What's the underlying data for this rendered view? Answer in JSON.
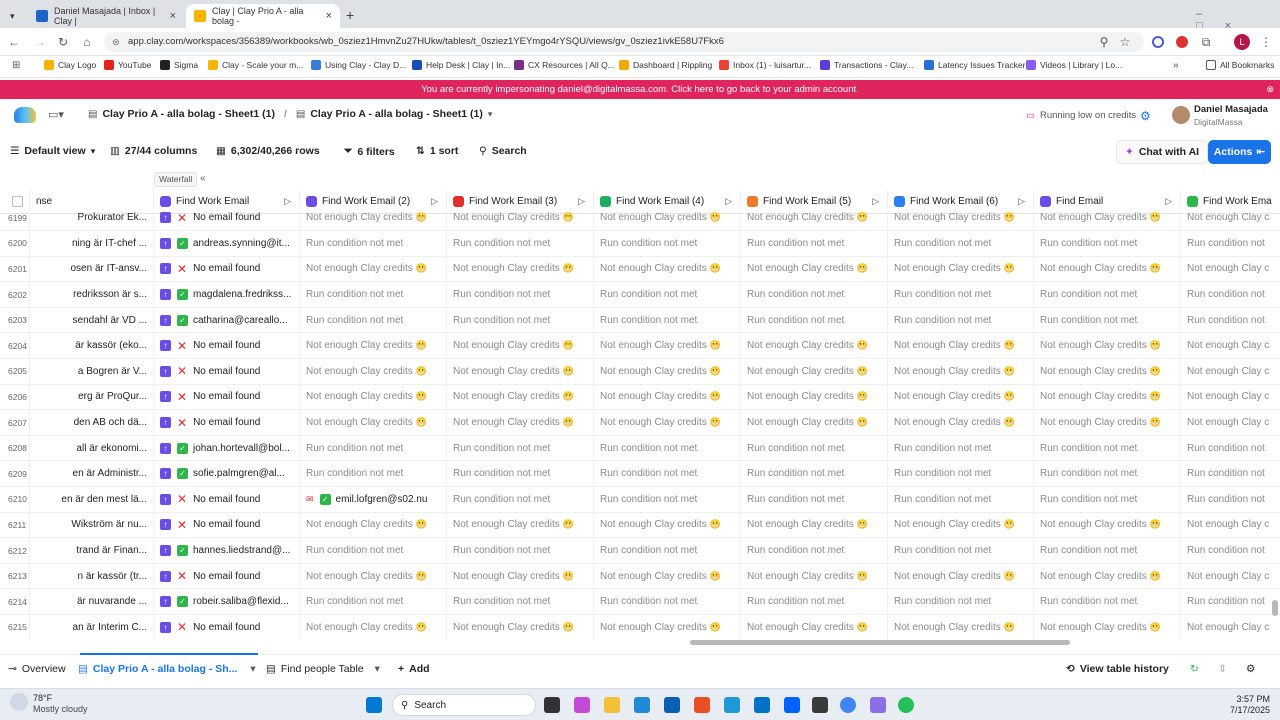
{
  "browser": {
    "tabs": [
      {
        "title": "Daniel Masajada | Inbox | Clay |"
      },
      {
        "title": "Clay | Clay Prio A - alla bolag -"
      }
    ],
    "url": "app.clay.com/workspaces/356389/workbooks/wb_0sziez1HmvnZu27HUkw/tables/t_0sziez1YEYmgo4rYSQU/views/gv_0sziez1ivkE58U7Fkx6",
    "bookmarks": [
      "Clay Logo",
      "YouTube",
      "Sigma",
      "Clay - Scale your m...",
      "Using Clay - Clay D...",
      "Help Desk | Clay | In...",
      "CX Resources | All Q...",
      "Dashboard | Rippling",
      "Inbox (1) - luisartur...",
      "Transactions - Clay...",
      "Latency Issues Tracker",
      "Videos | Library | Lo...",
      "All Bookmarks"
    ]
  },
  "banner": {
    "text": "You are currently impersonating daniel@digitalmassa.com. Click here to go back to your admin account."
  },
  "header": {
    "crumb1": "Clay Prio A - alla bolag - Sheet1 (1)",
    "crumb2": "Clay Prio A - alla bolag - Sheet1 (1)",
    "credits": "Running low on credits",
    "user_name": "Daniel Masajada",
    "user_org": "DigitalMassa"
  },
  "toolbar": {
    "view": "Default view",
    "columns": "27/44 columns",
    "rows": "6,302/40,266 rows",
    "filters": "6 filters",
    "sort": "1 sort",
    "search": "Search",
    "chat": "Chat with AI",
    "actions": "Actions"
  },
  "waterfall_label": "Waterfall",
  "columns": [
    "nse",
    "Find Work Email",
    "Find Work Email (2)",
    "Find Work Email (3)",
    "Find Work Email (4)",
    "Find Work Email (5)",
    "Find Work Email (6)",
    "Find Email",
    "Find Work Ema"
  ],
  "column_icon_colors": [
    "#6b4de6",
    "#6b4de6",
    "#e0302e",
    "#1fae5d",
    "#f07a2a",
    "#2a7ef0",
    "#6b4de6",
    "#2fb54a"
  ],
  "rows": [
    {
      "n": "6199",
      "c0": "Prokurator Ek...",
      "status": "no",
      "c1": "No email found",
      "c2": "Not enough Clay credits",
      "c3": "Not enough Clay credits",
      "c4": "Not enough Clay credits",
      "c5": "Not enough Clay credits",
      "c6": "Not enough Clay credits",
      "c7": "Not enough Clay credits",
      "c8": "Not enough Clay c"
    },
    {
      "n": "6200",
      "c0": "ning är IT-chef ...",
      "status": "ok",
      "c1": "andreas.synning@it...",
      "c2": "Run condition not met",
      "c3": "Run condition not met",
      "c4": "Run condition not met",
      "c5": "Run condition not met",
      "c6": "Run condition not met",
      "c7": "Run condition not met",
      "c8": "Run condition not"
    },
    {
      "n": "6201",
      "c0": "osen är IT-ansv...",
      "status": "no",
      "c1": "No email found",
      "c2": "Not enough Clay credits",
      "c3": "Not enough Clay credits",
      "c4": "Not enough Clay credits",
      "c5": "Not enough Clay credits",
      "c6": "Not enough Clay credits",
      "c7": "Not enough Clay credits",
      "c8": "Not enough Clay c"
    },
    {
      "n": "6202",
      "c0": "redriksson är s...",
      "status": "ok",
      "c1": "magdalena.fredrikss...",
      "c2": "Run condition not met",
      "c3": "Run condition not met",
      "c4": "Run condition not met",
      "c5": "Run condition not met",
      "c6": "Run condition not met",
      "c7": "Run condition not met",
      "c8": "Run condition not"
    },
    {
      "n": "6203",
      "c0": "sendahl är VD ...",
      "status": "ok",
      "c1": "catharina@careallo...",
      "c2": "Run condition not met",
      "c3": "Run condition not met",
      "c4": "Run condition not met",
      "c5": "Run condition not met",
      "c6": "Run condition not met",
      "c7": "Run condition not met",
      "c8": "Run condition not"
    },
    {
      "n": "6204",
      "c0": "är kassör (eko...",
      "status": "no",
      "c1": "No email found",
      "c2": "Not enough Clay credits",
      "c3": "Not enough Clay credits",
      "c4": "Not enough Clay credits",
      "c5": "Not enough Clay credits",
      "c6": "Not enough Clay credits",
      "c7": "Not enough Clay credits",
      "c8": "Not enough Clay c"
    },
    {
      "n": "6205",
      "c0": "a Bogren är V...",
      "status": "no",
      "c1": "No email found",
      "c2": "Not enough Clay credits",
      "c3": "Not enough Clay credits",
      "c4": "Not enough Clay credits",
      "c5": "Not enough Clay credits",
      "c6": "Not enough Clay credits",
      "c7": "Not enough Clay credits",
      "c8": "Not enough Clay c"
    },
    {
      "n": "6206",
      "c0": "erg är ProQur...",
      "status": "no",
      "c1": "No email found",
      "c2": "Not enough Clay credits",
      "c3": "Not enough Clay credits",
      "c4": "Not enough Clay credits",
      "c5": "Not enough Clay credits",
      "c6": "Not enough Clay credits",
      "c7": "Not enough Clay credits",
      "c8": "Not enough Clay c"
    },
    {
      "n": "6207",
      "c0": "den AB och dä...",
      "status": "no",
      "c1": "No email found",
      "c2": "Not enough Clay credits",
      "c3": "Not enough Clay credits",
      "c4": "Not enough Clay credits",
      "c5": "Not enough Clay credits",
      "c6": "Not enough Clay credits",
      "c7": "Not enough Clay credits",
      "c8": "Not enough Clay c"
    },
    {
      "n": "6208",
      "c0": "all är ekonomi...",
      "status": "ok",
      "c1": "johan.hortevall@bol...",
      "c2": "Run condition not met",
      "c3": "Run condition not met",
      "c4": "Run condition not met",
      "c5": "Run condition not met",
      "c6": "Run condition not met",
      "c7": "Run condition not met",
      "c8": "Run condition not"
    },
    {
      "n": "6209",
      "c0": "en är Administr...",
      "status": "ok",
      "c1": "sofie.palmgren@al...",
      "c2": "Run condition not met",
      "c3": "Run condition not met",
      "c4": "Run condition not met",
      "c5": "Run condition not met",
      "c6": "Run condition not met",
      "c7": "Run condition not met",
      "c8": "Run condition not"
    },
    {
      "n": "6210",
      "c0": "en är den mest lä...",
      "status": "no",
      "c1": "No email found",
      "c2": "emil.lofgren@s02.nu",
      "c3": "Run condition not met",
      "c4": "Run condition not met",
      "c5": "Run condition not met",
      "c6": "Run condition not met",
      "c7": "Run condition not met",
      "c8": "Run condition not"
    },
    {
      "n": "6211",
      "c0": "Wikström är nu...",
      "status": "no",
      "c1": "No email found",
      "c2": "Not enough Clay credits",
      "c3": "Not enough Clay credits",
      "c4": "Not enough Clay credits",
      "c5": "Not enough Clay credits",
      "c6": "Not enough Clay credits",
      "c7": "Not enough Clay credits",
      "c8": "Not enough Clay c"
    },
    {
      "n": "6212",
      "c0": "trand är Finan...",
      "status": "ok",
      "c1": "hannes.liedstrand@...",
      "c2": "Run condition not met",
      "c3": "Run condition not met",
      "c4": "Run condition not met",
      "c5": "Run condition not met",
      "c6": "Run condition not met",
      "c7": "Run condition not met",
      "c8": "Run condition not"
    },
    {
      "n": "6213",
      "c0": "n är kassör (tr...",
      "status": "no",
      "c1": "No email found",
      "c2": "Not enough Clay credits",
      "c3": "Not enough Clay credits",
      "c4": "Not enough Clay credits",
      "c5": "Not enough Clay credits",
      "c6": "Not enough Clay credits",
      "c7": "Not enough Clay credits",
      "c8": "Not enough Clay c"
    },
    {
      "n": "6214",
      "c0": "är nuvarande ...",
      "status": "ok",
      "c1": "robeir.saliba@flexid...",
      "c2": "Run condition not met",
      "c3": "Run condition not met",
      "c4": "Run condition not met",
      "c5": "Run condition not met",
      "c6": "Run condition not met",
      "c7": "Run condition not met",
      "c8": "Run condition not"
    },
    {
      "n": "6215",
      "c0": "an är Interim C...",
      "status": "no",
      "c1": "No email found",
      "c2": "Not enough Clay credits",
      "c3": "Not enough Clay credits",
      "c4": "Not enough Clay credits",
      "c5": "Not enough Clay credits",
      "c6": "Not enough Clay credits",
      "c7": "Not enough Clay credits",
      "c8": "Not enough Clay c"
    }
  ],
  "bottom": {
    "overview": "Overview",
    "active_tab": "Clay Prio A - alla bolag - Sh...",
    "tab2": "Find people Table",
    "add": "Add",
    "history": "View table history"
  },
  "taskbar": {
    "temp": "78°F",
    "weather": "Mostly cloudy",
    "search": "Search",
    "time": "3:57 PM",
    "date": "7/17/2025"
  },
  "colors": {
    "banner": "#e0245e",
    "accent": "#1a73e8",
    "ok": "#2fb54a",
    "no": "#e0302e"
  }
}
